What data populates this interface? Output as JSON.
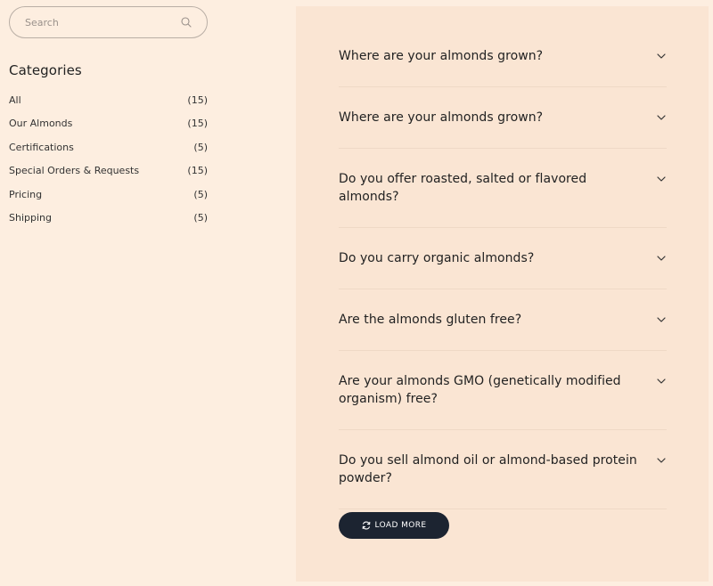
{
  "search": {
    "placeholder": "Search",
    "icon": "search-icon"
  },
  "categories": {
    "title": "Categories",
    "items": [
      {
        "label": "All",
        "count": "(15)"
      },
      {
        "label": "Our Almonds",
        "count": "(15)"
      },
      {
        "label": "Certifications",
        "count": "(5)"
      },
      {
        "label": "Special Orders & Requests",
        "count": "(15)"
      },
      {
        "label": "Pricing",
        "count": "(5)"
      },
      {
        "label": "Shipping",
        "count": "(5)"
      }
    ]
  },
  "faq": {
    "items": [
      {
        "question": "Where are your almonds grown?"
      },
      {
        "question": "Where are your almonds grown?"
      },
      {
        "question": "Do you offer roasted, salted or flavored almonds?"
      },
      {
        "question": "Do you carry organic almonds?"
      },
      {
        "question": "Are the almonds gluten free?"
      },
      {
        "question": "Are your almonds GMO (genetically modified organism) free?"
      },
      {
        "question": "Do you sell almond oil or almond-based protein powder?"
      }
    ],
    "expand_icon": "chevron-down-icon"
  },
  "load_more": {
    "label": "LOAD MORE",
    "icon": "refresh-icon"
  },
  "colors": {
    "page_bg": "#fdeee0",
    "panel_bg": "#fae5d3",
    "button_bg": "#1c2431",
    "divider": "#efd9c6"
  }
}
